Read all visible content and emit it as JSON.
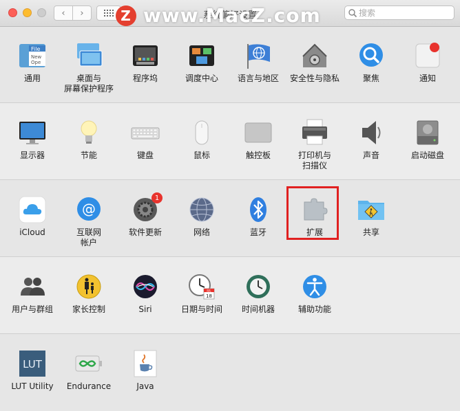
{
  "window": {
    "title": "系统偏好设置",
    "search_placeholder": "搜索"
  },
  "watermark": {
    "logo": "Z",
    "text": "www.MacZ.com"
  },
  "rows": [
    [
      {
        "key": "general",
        "label": "通用",
        "icon": "general-icon"
      },
      {
        "key": "desktop",
        "label": "桌面与\n屏幕保护程序",
        "icon": "desktop-screensaver-icon"
      },
      {
        "key": "dock",
        "label": "程序坞",
        "icon": "dock-icon"
      },
      {
        "key": "mission",
        "label": "调度中心",
        "icon": "mission-control-icon"
      },
      {
        "key": "language",
        "label": "语言与地区",
        "icon": "language-region-icon"
      },
      {
        "key": "security",
        "label": "安全性与隐私",
        "icon": "security-privacy-icon"
      },
      {
        "key": "spotlight",
        "label": "聚焦",
        "icon": "spotlight-icon"
      },
      {
        "key": "notifications",
        "label": "通知",
        "icon": "notifications-icon"
      }
    ],
    [
      {
        "key": "displays",
        "label": "显示器",
        "icon": "displays-icon"
      },
      {
        "key": "energy",
        "label": "节能",
        "icon": "energy-saver-icon"
      },
      {
        "key": "keyboard",
        "label": "键盘",
        "icon": "keyboard-icon"
      },
      {
        "key": "mouse",
        "label": "鼠标",
        "icon": "mouse-icon"
      },
      {
        "key": "trackpad",
        "label": "触控板",
        "icon": "trackpad-icon"
      },
      {
        "key": "printers",
        "label": "打印机与\n扫描仪",
        "icon": "printers-scanners-icon"
      },
      {
        "key": "sound",
        "label": "声音",
        "icon": "sound-icon"
      },
      {
        "key": "startup",
        "label": "启动磁盘",
        "icon": "startup-disk-icon"
      }
    ],
    [
      {
        "key": "icloud",
        "label": "iCloud",
        "icon": "icloud-icon"
      },
      {
        "key": "internet",
        "label": "互联网\n帐户",
        "icon": "internet-accounts-icon"
      },
      {
        "key": "swupdate",
        "label": "软件更新",
        "icon": "software-update-icon",
        "badge": "1"
      },
      {
        "key": "network",
        "label": "网络",
        "icon": "network-icon"
      },
      {
        "key": "bluetooth",
        "label": "蓝牙",
        "icon": "bluetooth-icon"
      },
      {
        "key": "extensions",
        "label": "扩展",
        "icon": "extensions-icon"
      },
      {
        "key": "sharing",
        "label": "共享",
        "icon": "sharing-icon"
      }
    ],
    [
      {
        "key": "users",
        "label": "用户与群组",
        "icon": "users-groups-icon"
      },
      {
        "key": "parental",
        "label": "家长控制",
        "icon": "parental-controls-icon"
      },
      {
        "key": "siri",
        "label": "Siri",
        "icon": "siri-icon"
      },
      {
        "key": "datetime",
        "label": "日期与时间",
        "icon": "date-time-icon"
      },
      {
        "key": "timemachine",
        "label": "时间机器",
        "icon": "time-machine-icon"
      },
      {
        "key": "accessibility",
        "label": "辅助功能",
        "icon": "accessibility-icon"
      }
    ],
    [
      {
        "key": "lut",
        "label": "LUT Utility",
        "icon": "lut-utility-icon"
      },
      {
        "key": "endurance",
        "label": "Endurance",
        "icon": "endurance-icon"
      },
      {
        "key": "java",
        "label": "Java",
        "icon": "java-icon"
      }
    ]
  ],
  "icon_text": {
    "general": [
      "File",
      "New",
      "Ope"
    ],
    "datetime": [
      "JUL",
      "18"
    ],
    "lut": "LUT"
  }
}
